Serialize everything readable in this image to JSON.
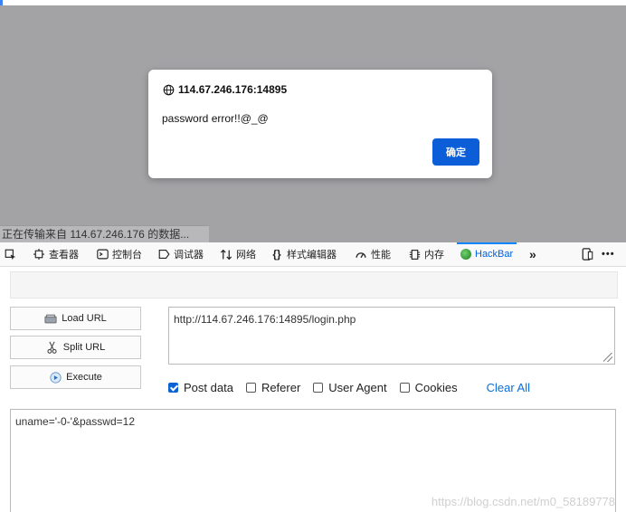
{
  "dialog": {
    "origin": "114.67.246.176:14895",
    "message": "password error!!@_@",
    "ok_label": "确定"
  },
  "status_text": "正在传输来自 114.67.246.176 的数据...",
  "devtools": {
    "tabs": [
      {
        "label": "查看器",
        "icon": "inspector-icon"
      },
      {
        "label": "控制台",
        "icon": "console-icon"
      },
      {
        "label": "调试器",
        "icon": "debugger-icon"
      },
      {
        "label": "网络",
        "icon": "network-icon"
      },
      {
        "label": "样式编辑器",
        "icon": "style-editor-icon"
      },
      {
        "label": "性能",
        "icon": "performance-icon"
      },
      {
        "label": "内存",
        "icon": "memory-icon"
      },
      {
        "label": "HackBar",
        "icon": "hackbar-icon",
        "active": true
      }
    ]
  },
  "hackbar": {
    "load_url_label": "Load URL",
    "split_url_label": "Split URL",
    "execute_label": "Execute",
    "url_value": "http://114.67.246.176:14895/login.php",
    "checks": [
      {
        "label": "Post data",
        "checked": true
      },
      {
        "label": "Referer",
        "checked": false
      },
      {
        "label": "User Agent",
        "checked": false
      },
      {
        "label": "Cookies",
        "checked": false
      }
    ],
    "clear_all_label": "Clear All",
    "post_value": "uname='-0-'&passwd=12"
  },
  "watermark": "https://blog.csdn.net/m0_58189778",
  "colors": {
    "accent": "#0b5ed7",
    "page_dim": "#a3a3a6"
  }
}
